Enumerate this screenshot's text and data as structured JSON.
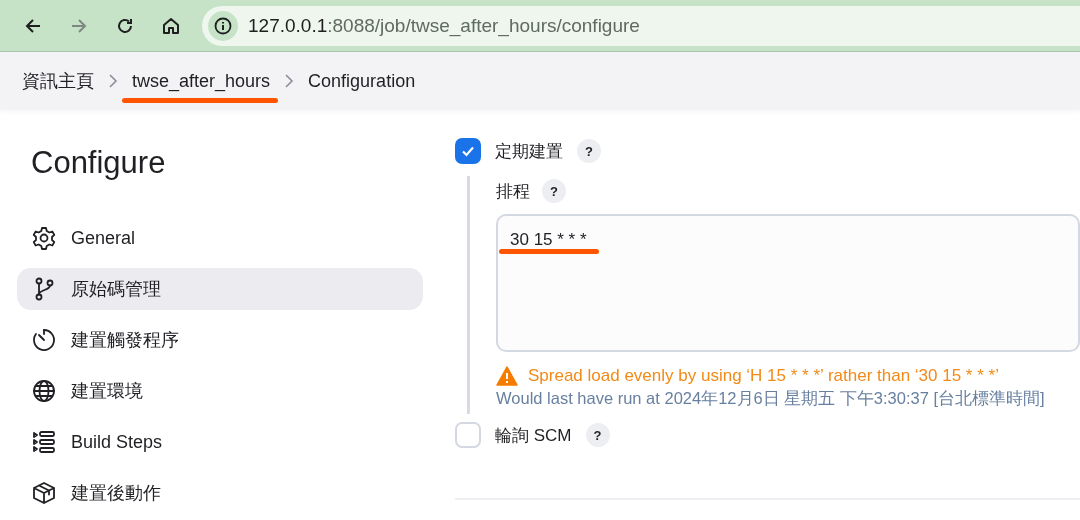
{
  "browser": {
    "url_host": "127.0.0.1",
    "url_rest": ":8088/job/twse_after_hours/configure"
  },
  "breadcrumbs": [
    {
      "label": "資訊主頁",
      "highlighted": false
    },
    {
      "label": "twse_after_hours",
      "highlighted": true
    },
    {
      "label": "Configuration",
      "highlighted": false
    }
  ],
  "sidebar": {
    "title": "Configure",
    "items": [
      {
        "label": "General",
        "selected": false
      },
      {
        "label": "原始碼管理",
        "selected": true
      },
      {
        "label": "建置觸發程序",
        "selected": false
      },
      {
        "label": "建置環境",
        "selected": false
      },
      {
        "label": "Build Steps",
        "selected": false
      },
      {
        "label": "建置後動作",
        "selected": false
      }
    ]
  },
  "triggers": [
    {
      "label": "定期建置",
      "help": "?",
      "checked": true,
      "schedule": {
        "label": "排程",
        "help": "?",
        "value": "30 15 * * *",
        "highlighted": true,
        "warning": "Spread load evenly by using ‘H 15 * * *’ rather than ‘30 15 * * *’",
        "info": "Would last have run at 2024年12月6日 星期五 下午3:30:37 [台北標準時間]"
      }
    },
    {
      "label": "輪詢 SCM",
      "help": "?",
      "checked": false
    }
  ]
}
